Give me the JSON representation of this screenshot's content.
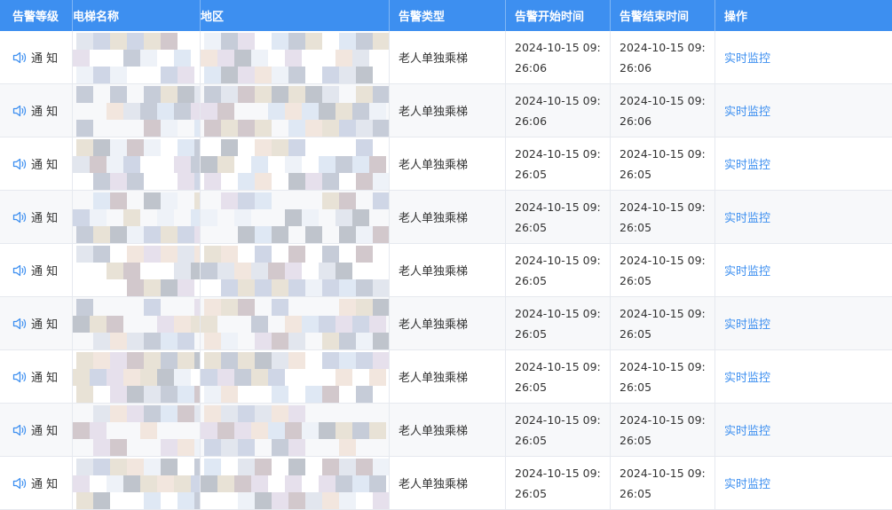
{
  "table": {
    "headers": [
      "告警等级",
      "电梯名称",
      "地区",
      "告警类型",
      "告警开始时间",
      "告警结束时间",
      "操作"
    ],
    "rows": [
      {
        "level": "通 知",
        "type": "老人单独乘梯",
        "start": "2024-10-15 09:26:06",
        "end": "2024-10-15 09:26:06",
        "action": "实时监控"
      },
      {
        "level": "通 知",
        "type": "老人单独乘梯",
        "start": "2024-10-15 09:26:06",
        "end": "2024-10-15 09:26:06",
        "action": "实时监控"
      },
      {
        "level": "通 知",
        "type": "老人单独乘梯",
        "start": "2024-10-15 09:26:05",
        "end": "2024-10-15 09:26:05",
        "action": "实时监控"
      },
      {
        "level": "通 知",
        "type": "老人单独乘梯",
        "start": "2024-10-15 09:26:05",
        "end": "2024-10-15 09:26:05",
        "action": "实时监控"
      },
      {
        "level": "通 知",
        "type": "老人单独乘梯",
        "start": "2024-10-15 09:26:05",
        "end": "2024-10-15 09:26:05",
        "action": "实时监控"
      },
      {
        "level": "通 知",
        "type": "老人单独乘梯",
        "start": "2024-10-15 09:26:05",
        "end": "2024-10-15 09:26:05",
        "action": "实时监控"
      },
      {
        "level": "通 知",
        "type": "老人单独乘梯",
        "start": "2024-10-15 09:26:05",
        "end": "2024-10-15 09:26:05",
        "action": "实时监控"
      },
      {
        "level": "通 知",
        "type": "老人单独乘梯",
        "start": "2024-10-15 09:26:05",
        "end": "2024-10-15 09:26:05",
        "action": "实时监控"
      },
      {
        "level": "通 知",
        "type": "老人单独乘梯",
        "start": "2024-10-15 09:26:05",
        "end": "2024-10-15 09:26:05",
        "action": "实时监控"
      }
    ]
  },
  "colors": {
    "header_bg": "#3d8ff0",
    "link": "#3d8ff0",
    "row_alt": "#f7f8fa"
  },
  "icons": {
    "level_icon": "speaker-icon"
  }
}
